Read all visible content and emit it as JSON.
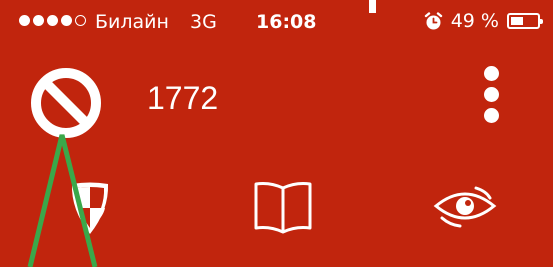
{
  "status_bar": {
    "signal_bars_filled": 4,
    "signal_bars_total": 5,
    "carrier": "Билайн",
    "network": "3G",
    "time": "16:08",
    "battery_percent_label": "49 %",
    "battery_level": 0.49,
    "alarm_icon": "alarm-clock-icon"
  },
  "header": {
    "block_icon": "block-icon",
    "number": "1772",
    "more_icon": "more-vertical-icon"
  },
  "tabs": [
    {
      "icon": "shield-icon"
    },
    {
      "icon": "book-icon"
    },
    {
      "icon": "eye-icon"
    }
  ],
  "colors": {
    "background": "#c1250d",
    "foreground": "#ffffff",
    "annotation": "#3aa84a"
  }
}
